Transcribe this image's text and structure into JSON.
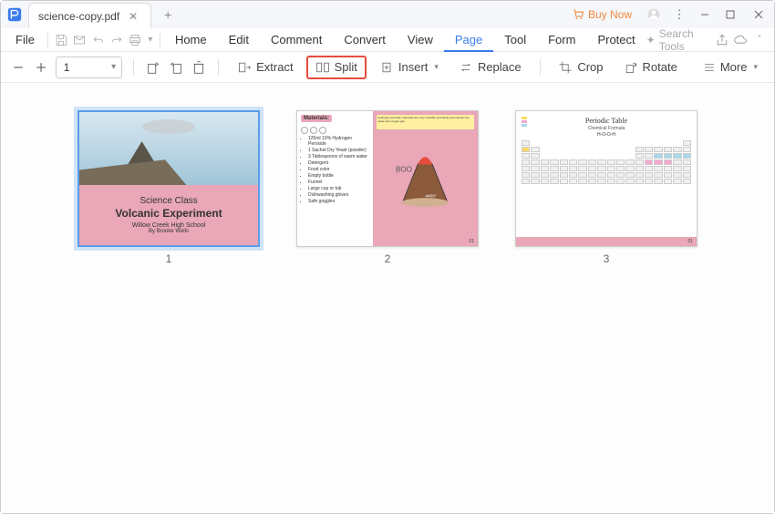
{
  "titlebar": {
    "filename": "science-copy.pdf",
    "buy_now": "Buy Now"
  },
  "menu": {
    "file": "File",
    "tabs": [
      "Home",
      "Edit",
      "Comment",
      "Convert",
      "View",
      "Page",
      "Tool",
      "Form",
      "Protect"
    ],
    "active_tab": "Page",
    "search_placeholder": "Search Tools"
  },
  "ribbon": {
    "page_value": "1",
    "extract": "Extract",
    "split": "Split",
    "insert": "Insert",
    "replace": "Replace",
    "crop": "Crop",
    "rotate": "Rotate",
    "more": "More"
  },
  "thumbnails": {
    "selected": 1,
    "labels": [
      "1",
      "2",
      "3"
    ]
  },
  "page1": {
    "line1": "Science Class",
    "line2": "Volcanic Experiment",
    "line3": "Willow Creek High School",
    "line4": "By Brooke Wells"
  },
  "page2": {
    "heading": "Materials:",
    "items": [
      "125ml 10% Hydrogen Peroxide",
      "1 Sachet Dry Yeast (powder)",
      "3 Tablespoons of warm water",
      "Detergent",
      "Food color",
      "Empty bottle",
      "Funnel",
      "Large cup or tub",
      "Dishwashing gloves",
      "Safe goggles"
    ]
  },
  "page3": {
    "title": "Periodic Table",
    "subtitle": "Chemical Formula",
    "formula": "H-O-O-H"
  }
}
